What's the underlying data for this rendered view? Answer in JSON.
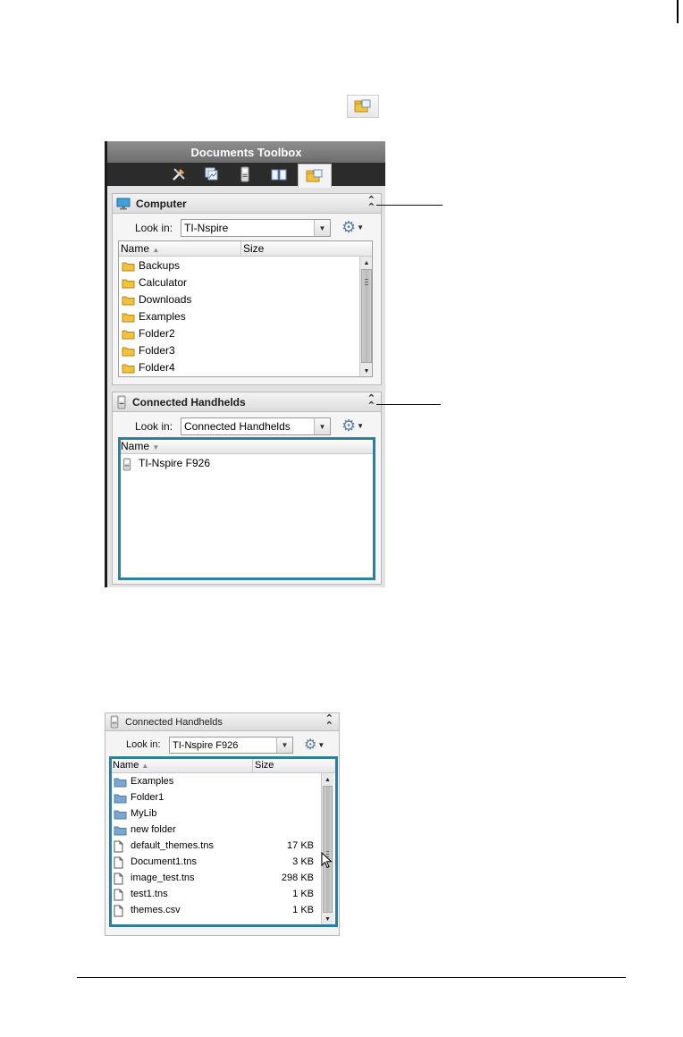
{
  "toolbox": {
    "title": "Documents Toolbox",
    "tabs": [
      {
        "name": "document-tools-icon"
      },
      {
        "name": "page-sorter-icon"
      },
      {
        "name": "handheld-emulator-icon"
      },
      {
        "name": "content-explorer-icon"
      },
      {
        "name": "utilities-icon",
        "active": true
      }
    ],
    "computer": {
      "title": "Computer",
      "look_in_label": "Look in:",
      "look_in_value": "TI-Nspire",
      "columns": {
        "name": "Name",
        "size": "Size"
      },
      "items": [
        "Backups",
        "Calculator",
        "Downloads",
        "Examples",
        "Folder2",
        "Folder3",
        "Folder4"
      ]
    },
    "handhelds": {
      "title": "Connected Handhelds",
      "look_in_label": "Look in:",
      "look_in_value": "Connected Handhelds",
      "columns": {
        "name": "Name"
      },
      "items": [
        "TI-Nspire F926"
      ]
    }
  },
  "panel2": {
    "title": "Connected Handhelds",
    "look_in_label": "Look in:",
    "look_in_value": "TI-Nspire F926",
    "columns": {
      "name": "Name",
      "size": "Size"
    },
    "folders": [
      "Examples",
      "Folder1",
      "MyLib",
      "new folder"
    ],
    "files": [
      {
        "name": "default_themes.tns",
        "size": "17 KB"
      },
      {
        "name": "Document1.tns",
        "size": "3 KB"
      },
      {
        "name": "image_test.tns",
        "size": "298 KB"
      },
      {
        "name": "test1.tns",
        "size": "1 KB"
      },
      {
        "name": "themes.csv",
        "size": "1 KB"
      }
    ]
  },
  "colors": {
    "highlight": "#2f7f9c",
    "folder": "#f2c23a",
    "blue_folder": "#7aa6cf"
  }
}
